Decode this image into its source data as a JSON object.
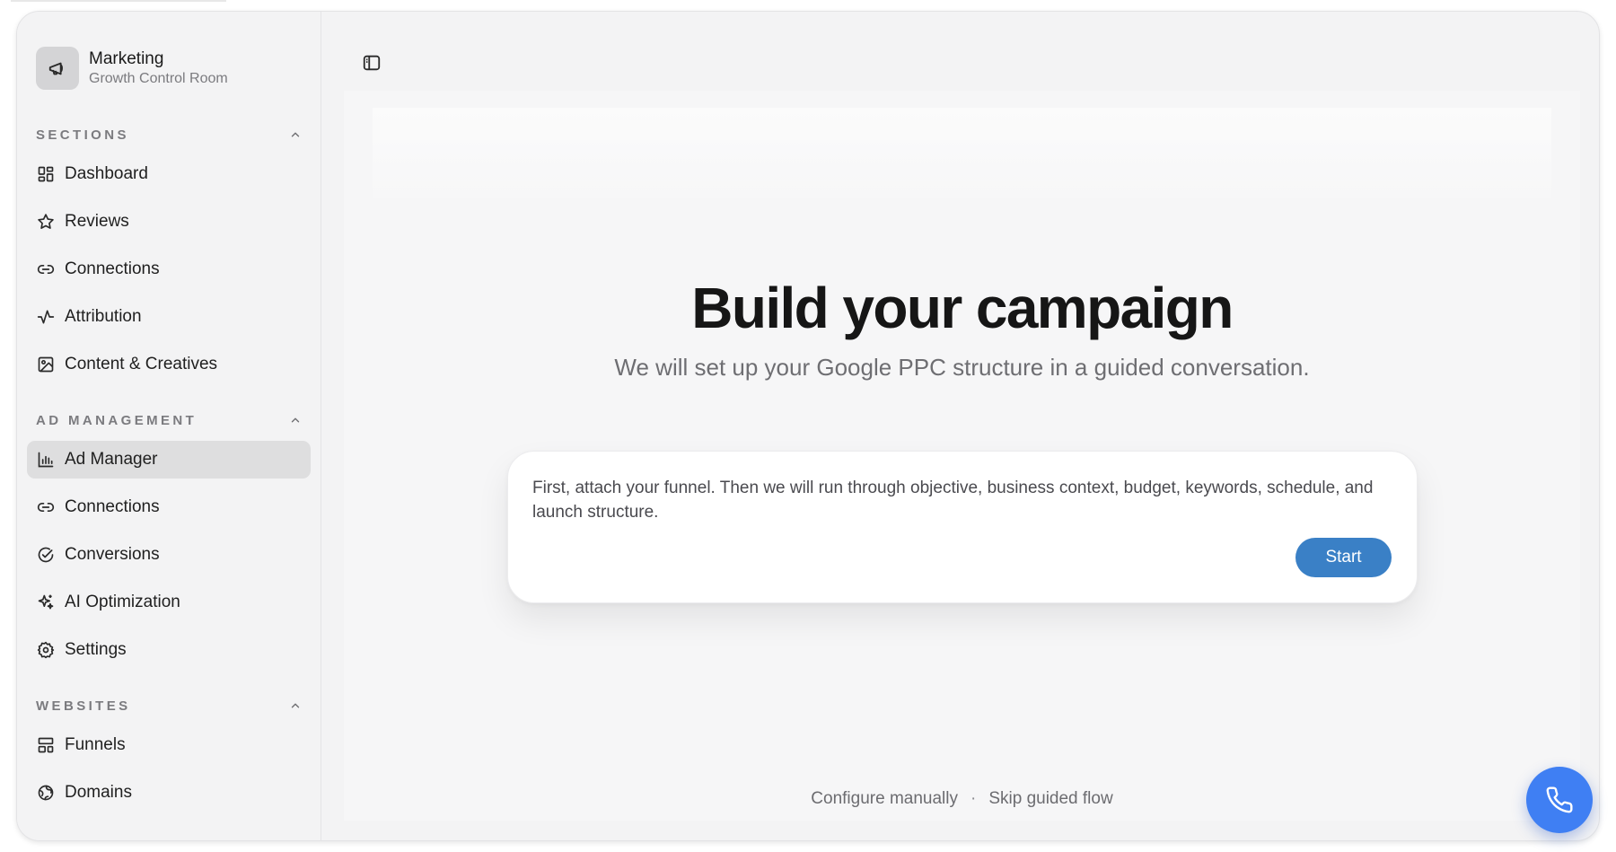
{
  "brand": {
    "title": "Marketing",
    "subtitle": "Growth Control Room",
    "icon": "megaphone-icon"
  },
  "sections": [
    {
      "title": "SECTIONS",
      "items": [
        {
          "label": "Dashboard",
          "icon": "dashboard-icon"
        },
        {
          "label": "Reviews",
          "icon": "star-icon"
        },
        {
          "label": "Connections",
          "icon": "link-icon"
        },
        {
          "label": "Attribution",
          "icon": "activity-icon"
        },
        {
          "label": "Content & Creatives",
          "icon": "image-icon"
        }
      ]
    },
    {
      "title": "AD MANAGEMENT",
      "items": [
        {
          "label": "Ad Manager",
          "icon": "bar-chart-icon",
          "active": true
        },
        {
          "label": "Connections",
          "icon": "link-icon"
        },
        {
          "label": "Conversions",
          "icon": "check-circle-icon"
        },
        {
          "label": "AI Optimization",
          "icon": "sparkles-icon"
        },
        {
          "label": "Settings",
          "icon": "gear-icon"
        }
      ]
    },
    {
      "title": "WEBSITES",
      "items": [
        {
          "label": "Funnels",
          "icon": "layout-icon"
        },
        {
          "label": "Domains",
          "icon": "globe-icon"
        }
      ]
    }
  ],
  "main": {
    "title": "Build your campaign",
    "subtitle": "We will set up your Google PPC structure in a guided conversation.",
    "card_text": "First, attach your funnel. Then we will run through objective, business context, budget, keywords, schedule, and launch structure.",
    "start_label": "Start",
    "footer": {
      "configure_label": "Configure manually",
      "separator": "·",
      "skip_label": "Skip guided flow"
    }
  },
  "colors": {
    "accent": "#3a80c6",
    "fab": "#3f7ff3",
    "active_bg": "#dededf"
  }
}
